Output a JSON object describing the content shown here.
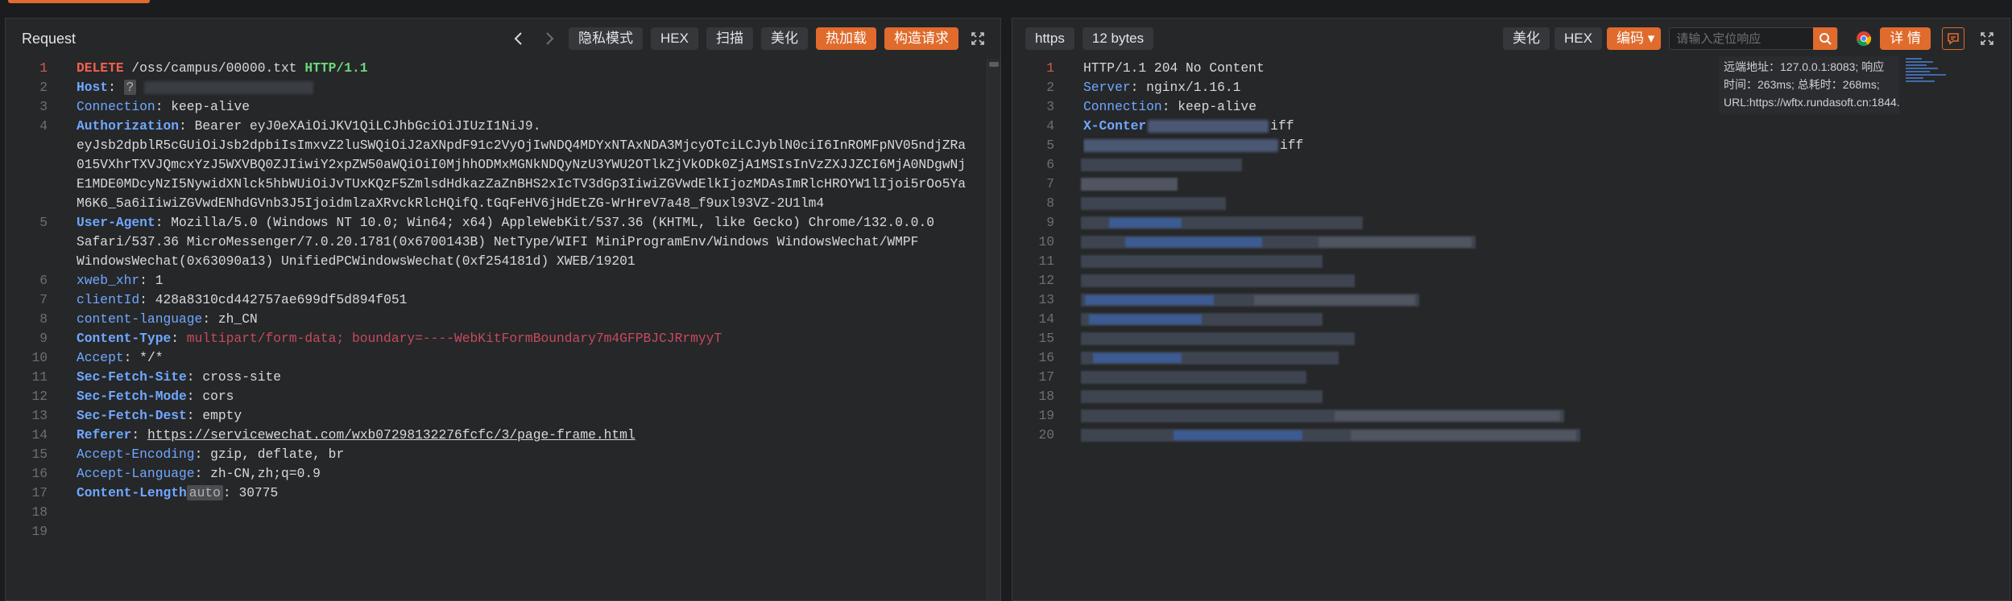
{
  "request_panel": {
    "title": "Request",
    "buttons": {
      "private_mode": "隐私模式",
      "hex": "HEX",
      "scan": "扫描",
      "beautify": "美化",
      "hot_load": "热加载",
      "construct": "构造请求"
    },
    "lines": [
      {
        "n": "1"
      },
      {
        "n": "2"
      },
      {
        "n": "3"
      },
      {
        "n": "4"
      },
      {
        "n": ""
      },
      {
        "n": ""
      },
      {
        "n": ""
      },
      {
        "n": ""
      },
      {
        "n": "5"
      },
      {
        "n": ""
      },
      {
        "n": ""
      },
      {
        "n": "6"
      },
      {
        "n": "7"
      },
      {
        "n": "8"
      },
      {
        "n": "9"
      },
      {
        "n": "10"
      },
      {
        "n": "11"
      },
      {
        "n": "12"
      },
      {
        "n": "13"
      },
      {
        "n": "14"
      },
      {
        "n": "15"
      },
      {
        "n": "16"
      },
      {
        "n": "17"
      },
      {
        "n": "18"
      },
      {
        "n": "19"
      }
    ],
    "text": {
      "method": "DELETE",
      "path": " /oss/campus/00000.txt ",
      "protocol": "HTTP/1.1",
      "host_key": "Host",
      "host_chip": "?",
      "connection_key": "Connection",
      "connection_val": " keep-alive",
      "auth_key": "Authorization",
      "auth_1": " Bearer eyJ0eXAiOiJKV1QiLCJhbGciOiJIUzI1NiJ9.",
      "auth_2": "eyJsb2dpblR5cGUiOiJsb2dpbiIsImxvZ2luSWQiOiJ2aXNpdF91c2VyOjIwNDQ4MDYxNTAxNDA3MjcyOTciLCJyblN0ciI6InROMFpNV05ndjZRa",
      "auth_3": "015VXhrTXVJQmcxYzJ5WXVBQ0ZJIiwiY2xpZW50aWQiOiI0MjhhODMxMGNkNDQyNzU3YWU2OTlkZjVkODk0ZjA1MSIsInVzZXJJZCI6MjA0NDgwNj",
      "auth_4": "E1MDE0MDcyNzI5NywidXNlck5hbWUiOiJvTUxKQzF5ZmlsdHdkazZaZnBHS2xIcTV3dGp3IiwiZGVwdElkIjozMDAsImRlcHROYW1lIjoi5rOo5Ya",
      "auth_5": "M6K6_5a6iIiwiZGVwdENhdGVnb3J5IjoidmlzaXRvckRlcHQifQ.tGqFeHV6jHdEtZG-WrHreV7a48_f9uxl93VZ-2U1lm4",
      "ua_key": "User-Agent",
      "ua_1": " Mozilla/5.0 (Windows NT 10.0; Win64; x64) AppleWebKit/537.36 (KHTML, like Gecko) Chrome/132.0.0.0",
      "ua_2": "Safari/537.36 MicroMessenger/7.0.20.1781(0x6700143B) NetType/WIFI MiniProgramEnv/Windows WindowsWechat/WMPF",
      "ua_3": "WindowsWechat(0x63090a13) UnifiedPCWindowsWechat(0xf254181d) XWEB/19201",
      "xhr_key": "xweb_xhr",
      "xhr_val": " 1",
      "client_key": "clientId",
      "client_val": " 428a8310cd442757ae699df5d894f051",
      "lang_key": "content-language",
      "lang_val": " zh_CN",
      "ctype_key": "Content-Type",
      "ctype_val": " multipart/form-data; boundary=----WebKitFormBoundary7m4GFPBJCJRrmyyT",
      "accept_key": "Accept",
      "accept_val": " */*",
      "sfs_key": "Sec-Fetch-Site",
      "sfs_val": " cross-site",
      "sfm_key": "Sec-Fetch-Mode",
      "sfm_val": " cors",
      "sfd_key": "Sec-Fetch-Dest",
      "sfd_val": " empty",
      "ref_key": "Referer",
      "ref_val": "https://servicewechat.com/wxb07298132276fcfc/3/page-frame.html",
      "enc_key": "Accept-Encoding",
      "enc_val": " gzip, deflate, br",
      "al_key": "Accept-Language",
      "al_val": " zh-CN,zh;q=0.9",
      "cl_key": "Content-Length",
      "cl_chip": "auto",
      "cl_val": " 30775"
    }
  },
  "response_panel": {
    "protocol_badge": "https",
    "size_badge": "12 bytes",
    "buttons": {
      "beautify": "美化",
      "hex": "HEX",
      "encoding": "编码"
    },
    "search_placeholder": "请输入定位响应",
    "details": "详 情",
    "lines": [
      "1",
      "2",
      "3",
      "4",
      "5",
      "6",
      "7",
      "8",
      "9",
      "10",
      "11",
      "12",
      "13",
      "14",
      "15",
      "16",
      "17",
      "18",
      "19",
      "20"
    ],
    "text": {
      "status": "HTTP/1.1 204 No Content",
      "server_key": "Server",
      "server_val": " nginx/1.16.1",
      "conn_key": "Connection",
      "conn_val": " keep-alive",
      "xcon_key": "X-Conter",
      "xcon_tail": "iff",
      "xcon_tail2": "iff"
    },
    "tooltip": "远端地址：127.0.0.1:8083; 响应时间：263ms; 总耗时：268ms; URL:https://wftx.rundasoft.cn:1844..."
  },
  "colors": {
    "accent": "#e06b2d",
    "key_blue": "#6fa8ff",
    "method_red": "#f2604f",
    "protocol_green": "#6bd87a"
  }
}
